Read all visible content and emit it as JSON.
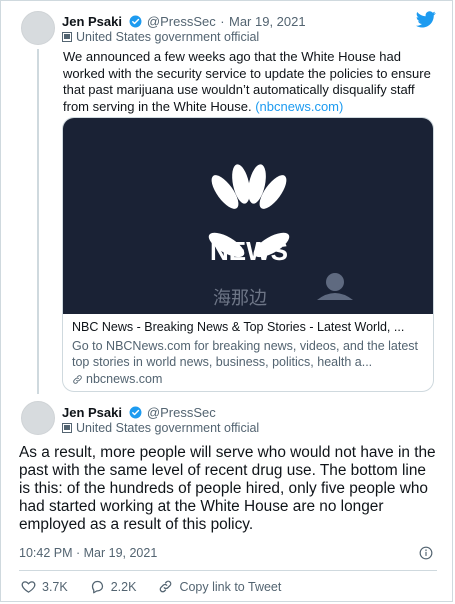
{
  "quoted": {
    "name": "Jen Psaki",
    "handle": "@PressSec",
    "sep": "·",
    "date": "Mar 19, 2021",
    "label": "United States government official",
    "text": "We announced a few weeks ago that the White House had worked with the security service to update the policies to ensure that past marijuana use wouldn’t automatically disqualify staff from serving in the White House.",
    "link": "(nbcnews.com)",
    "card": {
      "logo_text": "NEWS",
      "watermark": "海那边",
      "title": "NBC News - Breaking News & Top Stories - Latest World, ...",
      "description": "Go to NBCNews.com for breaking news, videos, and the latest top stories in world news, business, politics, health a...",
      "domain": "nbcnews.com"
    }
  },
  "main": {
    "name": "Jen Psaki",
    "handle": "@PressSec",
    "label": "United States government official",
    "text": "As a result, more people will serve who would not have in the past with the same level of recent drug use.   The bottom line is this: of the hundreds of people hired, only five people who had started working at the White House are no longer employed as a result of this policy.",
    "timestamp": "10:42 PM · Mar 19, 2021"
  },
  "actions": {
    "likes": "3.7K",
    "replies": "2.2K",
    "copy_link": "Copy link to Tweet"
  },
  "colors": {
    "accent": "#1d9bf0",
    "verified": "#1d9bf0",
    "text": "#0f1419",
    "muted": "#536471",
    "card_bg": "#1a2235"
  }
}
